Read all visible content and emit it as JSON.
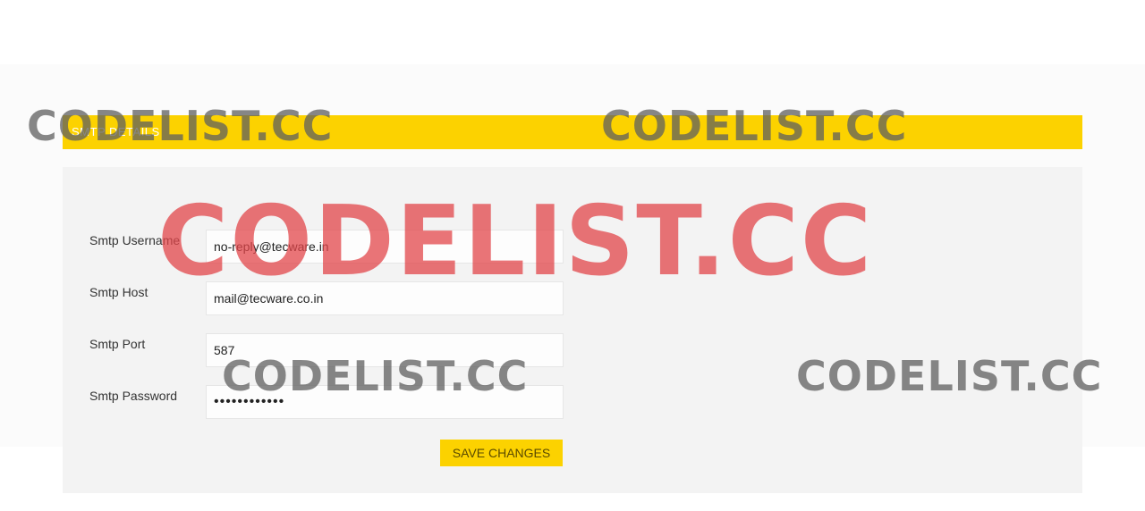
{
  "section": {
    "title": "SMTP DETAILS"
  },
  "form": {
    "fields": [
      {
        "label": "Smtp Username",
        "value": "no-reply@tecware.in"
      },
      {
        "label": "Smtp Host",
        "value": "mail@tecware.co.in"
      },
      {
        "label": "Smtp Port",
        "value": "587"
      },
      {
        "label": "Smtp Password",
        "value": "••••••••••••"
      }
    ],
    "save_label": "SAVE CHANGES"
  },
  "watermark": {
    "text": "CODELIST.CC"
  },
  "colors": {
    "accent": "#fcd200",
    "panel": "#f3f3f3",
    "watermark_red": "#e2464a",
    "watermark_gray": "#5f5f5f"
  }
}
